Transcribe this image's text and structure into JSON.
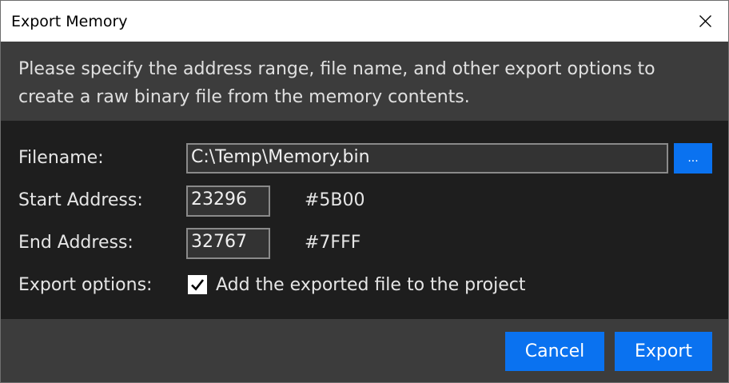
{
  "window": {
    "title": "Export Memory"
  },
  "description": "Please specify the address range, file name, and other export options to create a raw binary file from the memory contents.",
  "form": {
    "filename_label": "Filename:",
    "filename_value": "C:\\Temp\\Memory.bin",
    "browse_label": "...",
    "start_label": "Start Address:",
    "start_value": "23296",
    "start_hex": "#5B00",
    "end_label": "End Address:",
    "end_value": "32767",
    "end_hex": "#7FFF",
    "options_label": "Export options:",
    "add_to_project_label": "Add the exported file to the project",
    "add_to_project_checked": true
  },
  "buttons": {
    "cancel_label": "Cancel",
    "export_label": "Export"
  },
  "colors": {
    "accent": "#0a72f0",
    "panel": "#3c3c3c",
    "background": "#1e1e1e"
  },
  "icons": {
    "close": "close-icon",
    "check": "checkmark-icon"
  }
}
